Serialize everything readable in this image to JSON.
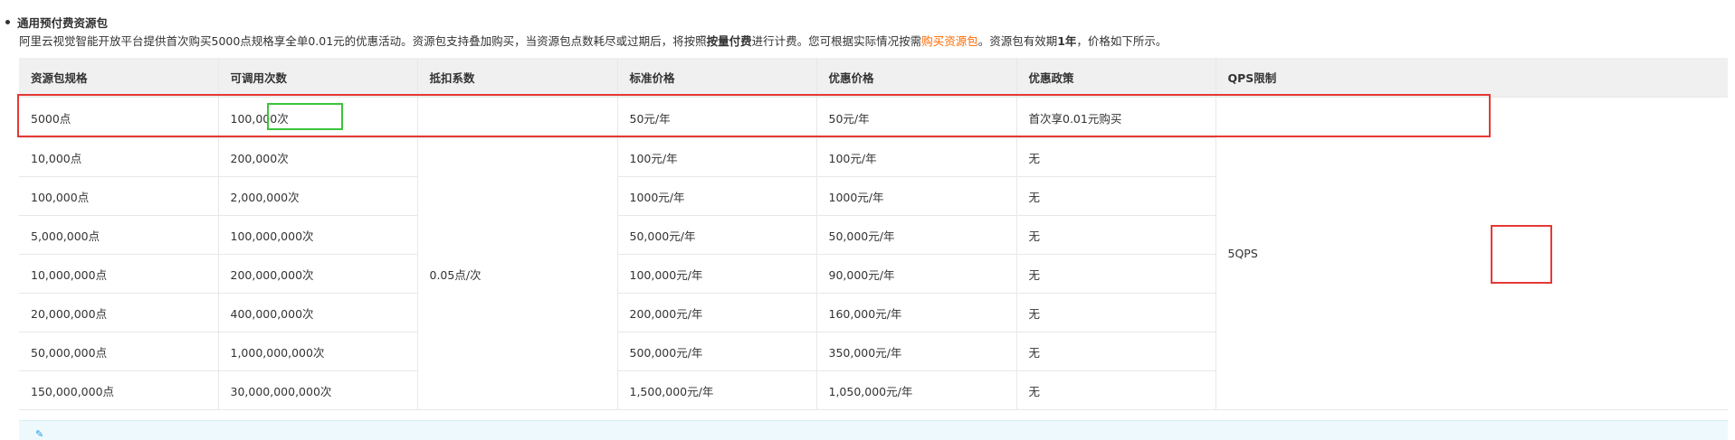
{
  "heading": "通用预付费资源包",
  "description": {
    "part1": "阿里云视觉智能开放平台提供首次购买5000点规格享全单0.01元的优惠活动。资源包支持叠加购买，当资源包点数耗尽或过期后，将按照",
    "bold1": "按量付费",
    "part2": "进行计费。您可根据实际情况按需",
    "link": "购买资源包",
    "part3": "。资源包有效期",
    "bold2": "1年",
    "part4": "，价格如下所示。"
  },
  "table": {
    "headers": [
      "资源包规格",
      "可调用次数",
      "抵扣系数",
      "标准价格",
      "优惠价格",
      "优惠政策",
      "QPS限制"
    ],
    "deduction": "0.05点/次",
    "qps": "5QPS",
    "rows": [
      {
        "spec": "5000点",
        "calls": "100,000次",
        "std": "50元/年",
        "promo": "50元/年",
        "policy": "首次享0.01元购买"
      },
      {
        "spec": "10,000点",
        "calls": "200,000次",
        "std": "100元/年",
        "promo": "100元/年",
        "policy": "无"
      },
      {
        "spec": "100,000点",
        "calls": "2,000,000次",
        "std": "1000元/年",
        "promo": "1000元/年",
        "policy": "无"
      },
      {
        "spec": "5,000,000点",
        "calls": "100,000,000次",
        "std": "50,000元/年",
        "promo": "50,000元/年",
        "policy": "无"
      },
      {
        "spec": "10,000,000点",
        "calls": "200,000,000次",
        "std": "100,000元/年",
        "promo": "90,000元/年",
        "policy": "无"
      },
      {
        "spec": "20,000,000点",
        "calls": "400,000,000次",
        "std": "200,000元/年",
        "promo": "160,000元/年",
        "policy": "无"
      },
      {
        "spec": "50,000,000点",
        "calls": "1,000,000,000次",
        "std": "500,000元/年",
        "promo": "350,000元/年",
        "policy": "无"
      },
      {
        "spec": "150,000,000点",
        "calls": "30,000,000,000次",
        "std": "1,500,000元/年",
        "promo": "1,050,000元/年",
        "policy": "无"
      }
    ]
  },
  "colors": {
    "link": "#ff6a00",
    "highlight_red": "#e53935",
    "highlight_green": "#3ac43a",
    "header_bg": "#f0f0f0",
    "note_bg": "#eef9fd"
  }
}
